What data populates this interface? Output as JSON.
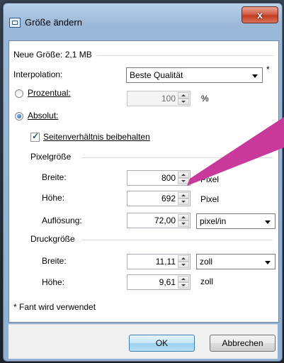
{
  "window": {
    "title": "Größe ändern",
    "close_glyph": "x"
  },
  "new_size": "Neue Größe: 2,1 MB",
  "interpolation": {
    "label": "Interpolation:",
    "value": "Beste Qualität",
    "asterisk": "*"
  },
  "percent": {
    "label": "Prozentual:",
    "value": "100",
    "unit": "%",
    "checked": false
  },
  "absolute": {
    "label": "Absolut:",
    "checked": true
  },
  "keep_ratio": {
    "label": "Seitenverhältnis beibehalten",
    "checked": true
  },
  "pixel_size": {
    "heading": "Pixelgröße",
    "width": {
      "label": "Breite:",
      "value": "800",
      "unit": "Pixel"
    },
    "height": {
      "label": "Höhe:",
      "value": "692",
      "unit": "Pixel"
    },
    "resolution": {
      "label": "Auflösung:",
      "value": "72,00",
      "unit": "pixel/in"
    }
  },
  "print_size": {
    "heading": "Druckgröße",
    "width": {
      "label": "Breite:",
      "value": "11,11",
      "unit": "zoll"
    },
    "height": {
      "label": "Höhe:",
      "value": "9,61",
      "unit": "zoll"
    }
  },
  "footnote": "* Fant wird verwendet",
  "buttons": {
    "ok": "OK",
    "cancel": "Abbrechen"
  },
  "colors": {
    "annotation_arrow": "#c8399a"
  }
}
